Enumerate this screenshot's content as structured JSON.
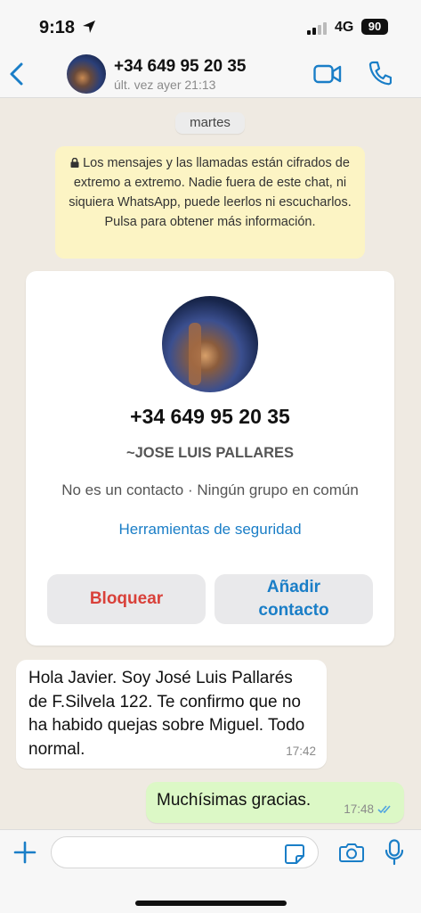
{
  "status_bar": {
    "time": "9:18",
    "network": "4G",
    "battery": "90"
  },
  "header": {
    "contact_name": "+34 649 95 20 35",
    "last_seen": "últ. vez ayer 21:13"
  },
  "chat": {
    "day_label": "martes",
    "encryption_notice": "Los mensajes y las llamadas están cifrados de extremo a extremo. Nadie fuera de este chat, ni siquiera WhatsApp, puede leerlos ni escucharlos. Pulsa para obtener más información.",
    "contact_card": {
      "phone": "+34 649 95 20 35",
      "nickname": "~JOSE LUIS PALLARES",
      "meta": "No es un contacto · Ningún grupo en común",
      "security_tools": "Herramientas de seguridad",
      "block_label": "Bloquear",
      "add_contact_label": "Añadir contacto"
    },
    "messages": [
      {
        "direction": "in",
        "text": "Hola Javier. Soy José Luis Pallarés de F.Silvela 122. Te confirmo que no ha habido quejas sobre Miguel. Todo normal.",
        "time": "17:42"
      },
      {
        "direction": "out",
        "text": "Muchísimas gracias.",
        "time": "17:48",
        "status": "read"
      }
    ]
  },
  "input_bar": {
    "placeholder": ""
  },
  "colors": {
    "accent": "#1a7ec7",
    "danger": "#d9413a",
    "outgoing_bubble": "#dcf8c6",
    "notice_bg": "#fcf4c4",
    "chat_bg": "#efeae2"
  },
  "icons": {
    "back": "chevron-left-icon",
    "video": "video-camera-icon",
    "call": "phone-icon",
    "attach": "plus-icon",
    "sticker": "sticker-icon",
    "camera": "camera-icon",
    "mic": "microphone-icon",
    "read_receipt": "double-check-icon"
  }
}
